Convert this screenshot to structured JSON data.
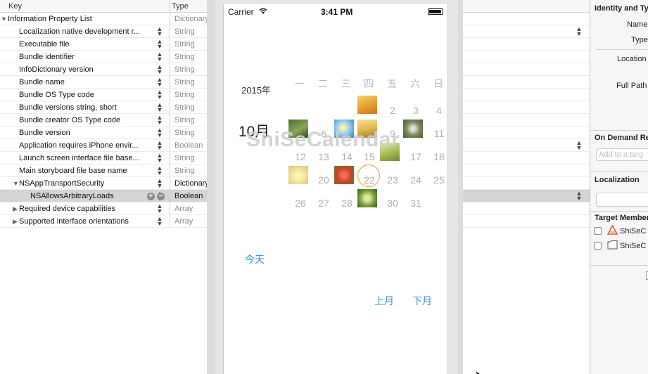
{
  "plist": {
    "header": {
      "key": "Key",
      "type": "Type"
    },
    "rows": [
      {
        "key": "Information Property List",
        "type": "Dictionary"
      },
      {
        "key": "Localization native development r...",
        "type": "String"
      },
      {
        "key": "Executable file",
        "type": "String"
      },
      {
        "key": "Bundle identifier",
        "type": "String"
      },
      {
        "key": "InfoDictionary version",
        "type": "String"
      },
      {
        "key": "Bundle name",
        "type": "String"
      },
      {
        "key": "Bundle OS Type code",
        "type": "String"
      },
      {
        "key": "Bundle versions string, short",
        "type": "String"
      },
      {
        "key": "Bundle creator OS Type code",
        "type": "String"
      },
      {
        "key": "Bundle version",
        "type": "String"
      },
      {
        "key": "Application requires iPhone envir...",
        "type": "Boolean"
      },
      {
        "key": "Launch screen interface file base...",
        "type": "String"
      },
      {
        "key": "Main storyboard file base name",
        "type": "String"
      },
      {
        "key": "NSAppTransportSecurity",
        "type": "Dictionary"
      },
      {
        "key": "NSAllowsArbitraryLoads",
        "type": "Boolean"
      },
      {
        "key": "Required device capabilities",
        "type": "Array"
      },
      {
        "key": "Supported interface orientations",
        "type": "Array"
      }
    ]
  },
  "phone": {
    "carrier": "Carrier",
    "time": "3:41 PM",
    "year": "2015年",
    "month": "10月",
    "watermark": "ShiSeCalendar",
    "weekdays": [
      "一",
      "二",
      "三",
      "四",
      "五",
      "六",
      "日"
    ],
    "days": [
      "2",
      "3",
      "4",
      "6",
      "9",
      "11",
      "12",
      "13",
      "14",
      "15",
      "17",
      "18",
      "20",
      "22",
      "23",
      "24",
      "25",
      "26",
      "27",
      "28",
      "30",
      "31"
    ],
    "today_button": "今天",
    "prev_button": "上月",
    "next_button": "下月"
  },
  "inspector": {
    "identity_title": "Identity and Typ",
    "name_label": "Name",
    "type_label": "Type",
    "location_label": "Location",
    "fullpath_label": "Full Path",
    "ondemand_title": "On Demand Re",
    "ondemand_placeholder": "Add to a targ",
    "localization_title": "Localization",
    "target_title": "Target Member",
    "targets": [
      "ShiSeC",
      "ShiSeC"
    ]
  }
}
